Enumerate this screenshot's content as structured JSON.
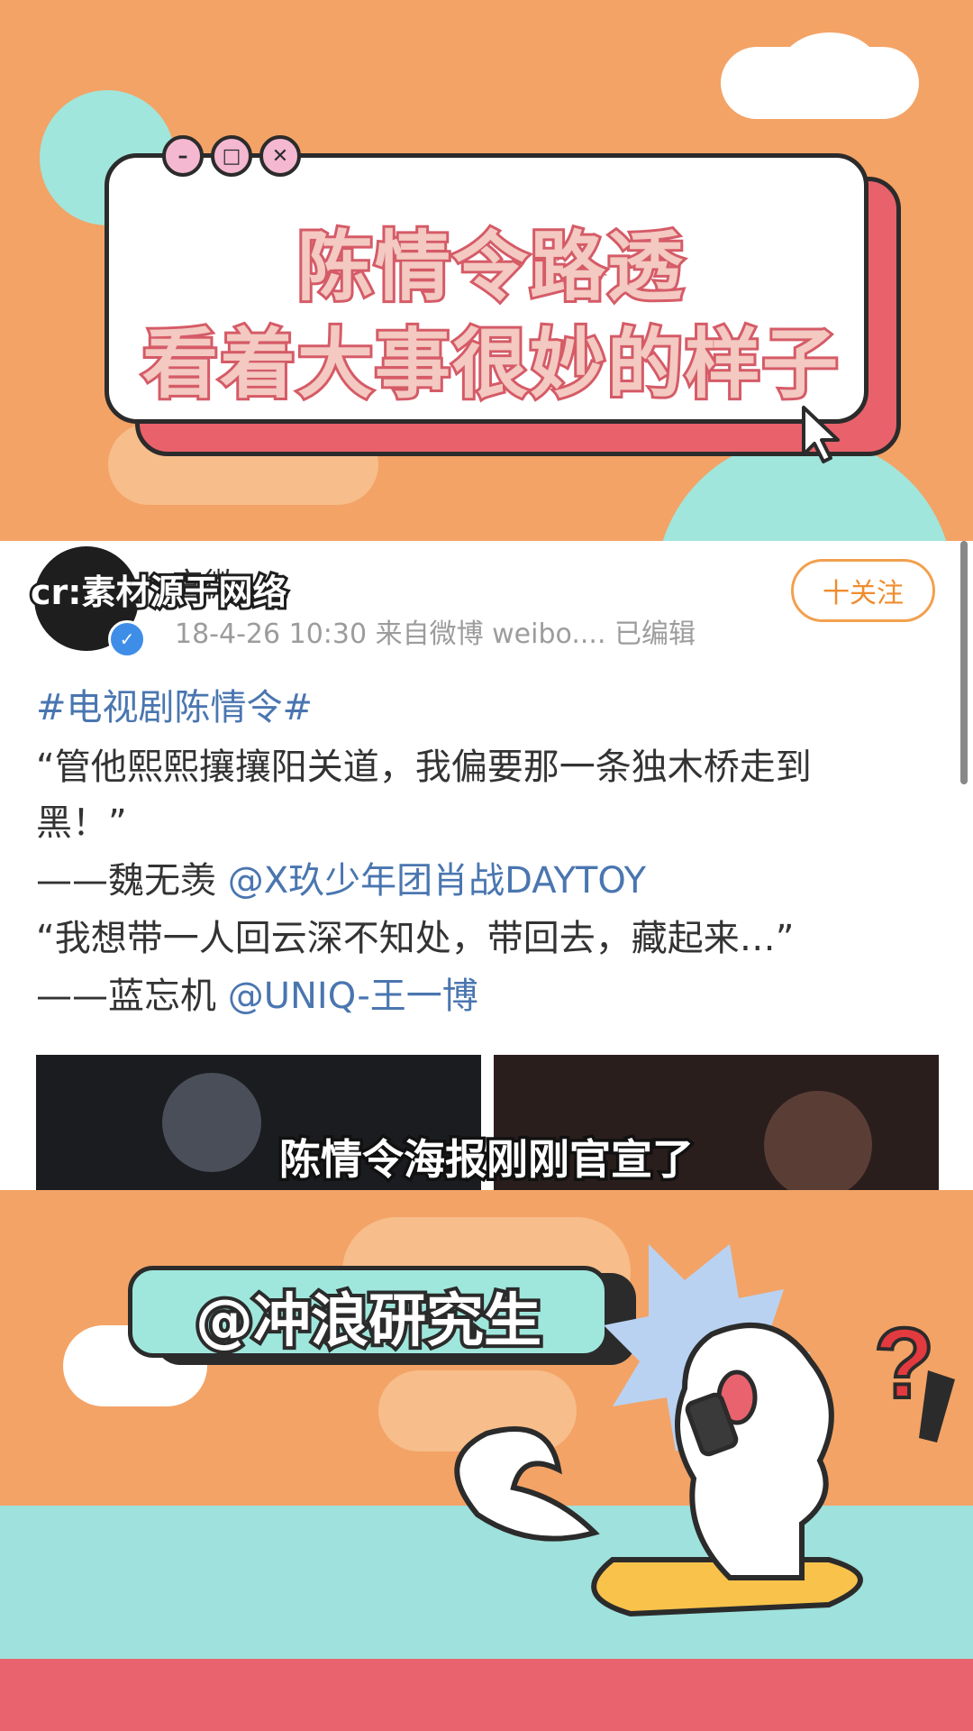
{
  "banner": {
    "title_line1": "陈情令路透",
    "title_line2": "看着大事很妙的样子",
    "window_buttons": [
      "minus-icon",
      "restore-icon",
      "close-icon"
    ]
  },
  "post": {
    "watermark": "cr:素材源于网络",
    "username": "宫微",
    "verified_badge": "✓",
    "follow_label": "十关注",
    "meta": "18-4-26 10:30  来自微博 weibo....  已编辑",
    "hashtag": "#电视剧陈情令#",
    "quote1_line1": "“管他熙熙攘攘阳关道，我偏要那一条独木桥走到",
    "quote1_line2": "黑！”",
    "attr1_prefix": "——魏无羡 ",
    "attr1_mention": "@X玖少年团肖战DAYTOY",
    "quote2": "“我想带一人回云深不知处，带回去，藏起来…”",
    "attr2_prefix": "——蓝忘机 ",
    "attr2_mention": "@UNIQ-王一博",
    "video_subtitle": "陈情令海报刚刚官宣了"
  },
  "footer": {
    "handle": "@冲浪研究生",
    "mascot": "surfing-ghost-mascot",
    "question_mark": "?"
  },
  "colors": {
    "background": "#F3A366",
    "title_fill": "#F3C9C1",
    "title_stroke": "#D55B67",
    "accent_pink": "#E9626B",
    "mint": "#9FE7DC",
    "mention_blue": "#4A76B0",
    "follow_orange": "#F08C2E"
  }
}
